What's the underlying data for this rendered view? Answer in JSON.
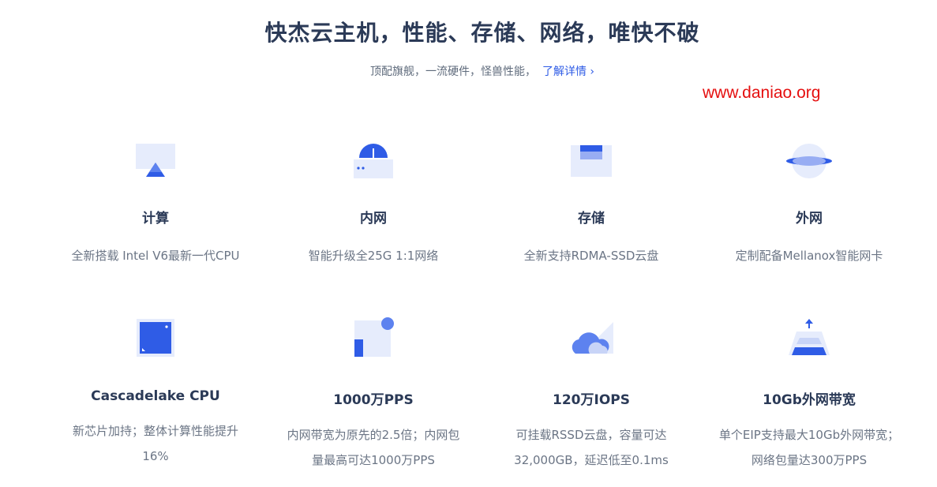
{
  "header": {
    "title": "快杰云主机，性能、存储、网络，唯快不破",
    "subtitle": "顶配旗舰，一流硬件，怪兽性能，",
    "more_link": "了解详情",
    "more_chevron": "›"
  },
  "watermark": "www.daniao.org",
  "colors": {
    "accent": "#2f5ce6",
    "title": "#2b3a57",
    "body": "#6b7585",
    "icon_light": "#e6ecfc",
    "watermark": "#e50f0f"
  },
  "features": [
    {
      "icon": "compute-icon",
      "title": "计算",
      "desc": "全新搭载 Intel V6最新一代CPU"
    },
    {
      "icon": "intranet-icon",
      "title": "内网",
      "desc": "智能升级全25G 1:1网络"
    },
    {
      "icon": "storage-icon",
      "title": "存储",
      "desc": "全新支持RDMA-SSD云盘"
    },
    {
      "icon": "extranet-icon",
      "title": "外网",
      "desc": "定制配备Mellanox智能网卡"
    },
    {
      "icon": "chip-icon",
      "title": "Cascadelake CPU",
      "desc": "新芯片加持；整体计算性能提升16%"
    },
    {
      "icon": "pps-icon",
      "title": "1000万PPS",
      "desc": "内网带宽为原先的2.5倍；内网包量最高可达1000万PPS"
    },
    {
      "icon": "cloud-disk-icon",
      "title": "120万IOPS",
      "desc": "可挂载RSSD云盘，容量可达32,000GB，延迟低至0.1ms"
    },
    {
      "icon": "bandwidth-icon",
      "title": "10Gb外网带宽",
      "desc": "单个EIP支持最大10Gb外网带宽；网络包量达300万PPS"
    }
  ]
}
